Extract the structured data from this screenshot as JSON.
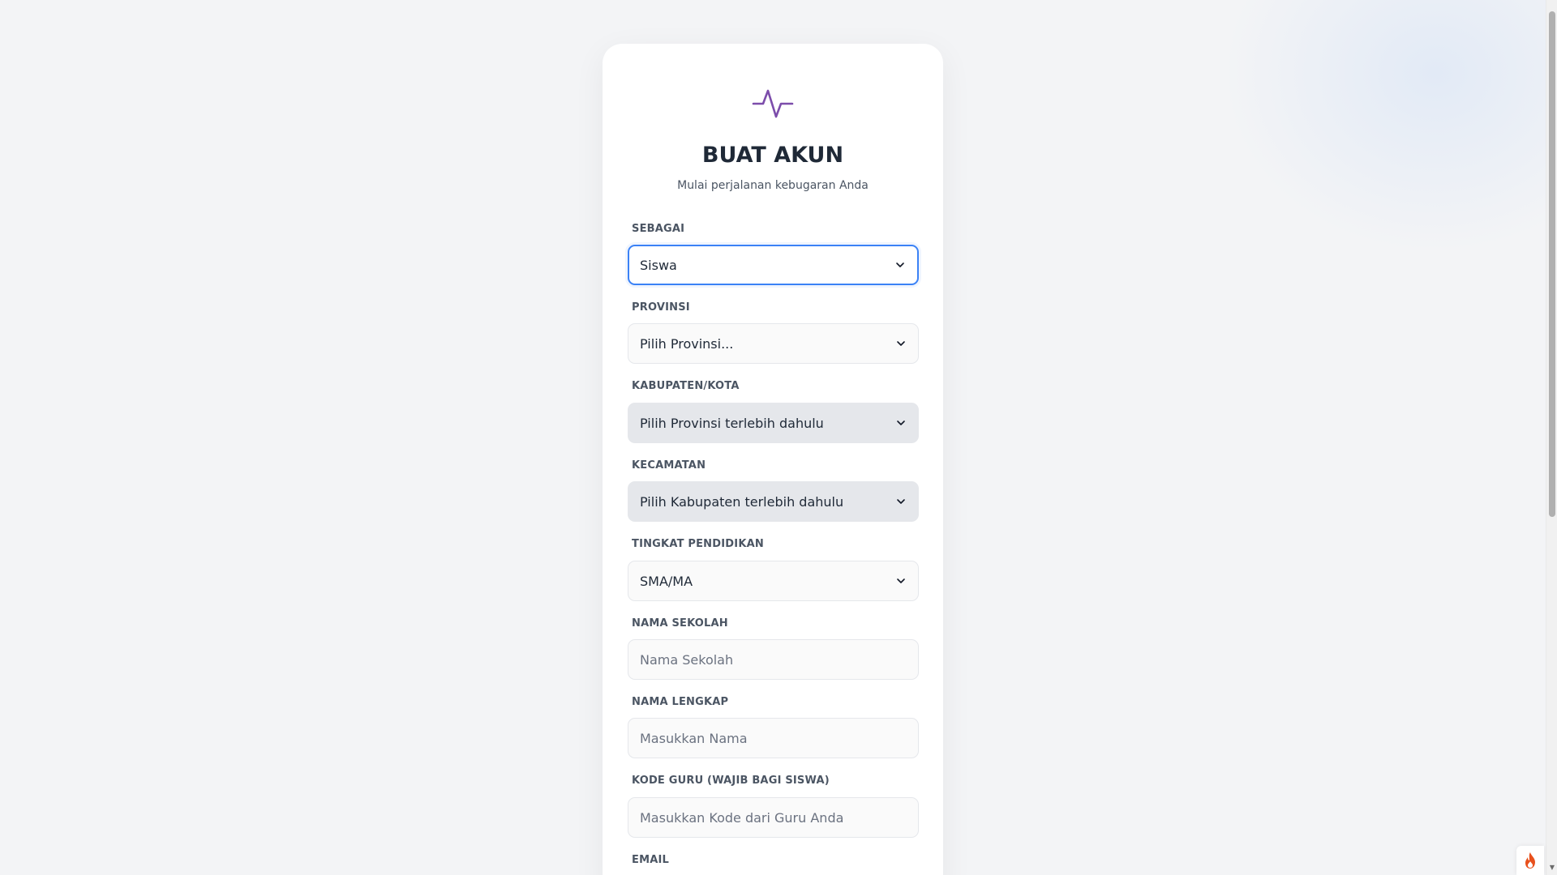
{
  "header": {
    "title": "BUAT AKUN",
    "subtitle": "Mulai perjalanan kebugaran Anda"
  },
  "form": {
    "role": {
      "label": "SEBAGAI",
      "value": "Siswa"
    },
    "province": {
      "label": "PROVINSI",
      "value": "Pilih Provinsi..."
    },
    "regency": {
      "label": "KABUPATEN/KOTA",
      "value": "Pilih Provinsi terlebih dahulu"
    },
    "district": {
      "label": "KECAMATAN",
      "value": "Pilih Kabupaten terlebih dahulu"
    },
    "education": {
      "label": "TINGKAT PENDIDIKAN",
      "value": "SMA/MA"
    },
    "school": {
      "label": "NAMA SEKOLAH",
      "placeholder": "Nama Sekolah"
    },
    "fullname": {
      "label": "NAMA LENGKAP",
      "placeholder": "Masukkan Nama"
    },
    "teacher_code": {
      "label": "KODE GURU (WAJIB BAGI SISWA)",
      "placeholder": "Masukkan Kode dari Guru Anda"
    },
    "email": {
      "label": "EMAIL"
    }
  },
  "icons": {
    "logo": "pulse-icon",
    "dropdown": "chevron-down-icon",
    "badge": "fire-icon"
  },
  "colors": {
    "accent_purple": "#7c4dab",
    "focus_blue": "#3b82f6",
    "title_dark": "#1f2937",
    "fire_orange": "#e8501c"
  }
}
